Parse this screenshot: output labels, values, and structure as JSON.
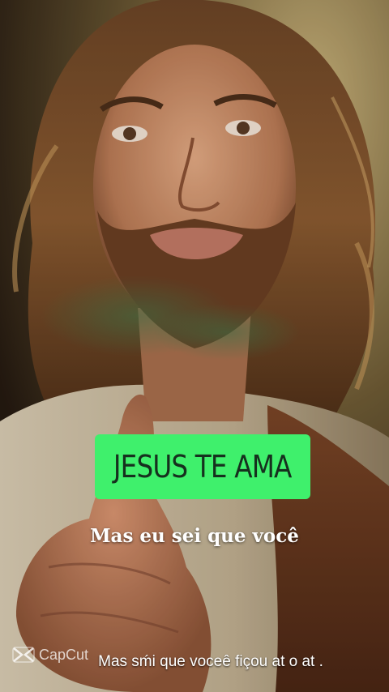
{
  "overlay": {
    "badge_text": "JESUS TE AMA",
    "caption": "Mas eu sei que você",
    "subtitle": "Mas sḿi que voceê fiçou at o at ."
  },
  "watermark": {
    "label": "CapCut",
    "icon": "capcut-logo-icon"
  },
  "colors": {
    "badge_green": "#3ff06c",
    "caption_white": "#ffffff"
  }
}
